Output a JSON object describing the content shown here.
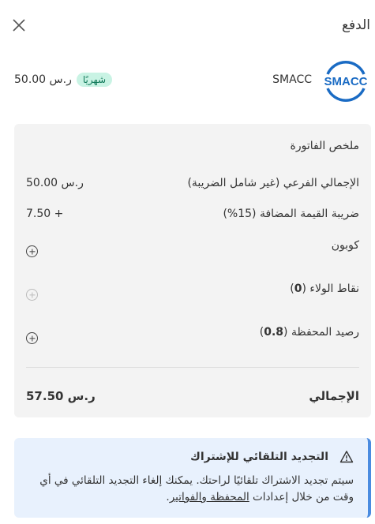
{
  "header": {
    "title": "الدفع"
  },
  "product": {
    "logo_text": "SMACC",
    "name": "SMACC",
    "badge": "شهريًا",
    "price": "50.00 ر.س"
  },
  "summary": {
    "heading": "ملخص الفاتورة",
    "subtotal_label": "الإجمالي الفرعي (غير شامل الضريبة)",
    "subtotal_value": "50.00 ر.س",
    "vat_label": "ضريبة القيمة المضافة (15%)",
    "vat_value": "7.50 +",
    "coupon_label": "كوبون",
    "loyalty_label_prefix": "نقاط الولاء (",
    "loyalty_value": "0",
    "loyalty_label_suffix": ")",
    "wallet_label_prefix": "رصيد المحفظة (",
    "wallet_value": "0.8",
    "wallet_label_suffix": ")",
    "total_label": "الإجمالي",
    "total_value": "57.50 ر.س"
  },
  "notice": {
    "title": "التجديد التلقائي للإشتراك",
    "text": "سيتم تجديد الاشتراك تلقائيًا لراحتك. يمكنك إلغاء التجديد التلقائي في أي وقت من خلال إعدادات ",
    "link": "المحفظة والفواتير",
    "text_end": "."
  },
  "colors": {
    "logo_blue": "#1a6bc4",
    "badge_bg": "#c9f3e4",
    "notice_bg": "#e8f1fd"
  }
}
